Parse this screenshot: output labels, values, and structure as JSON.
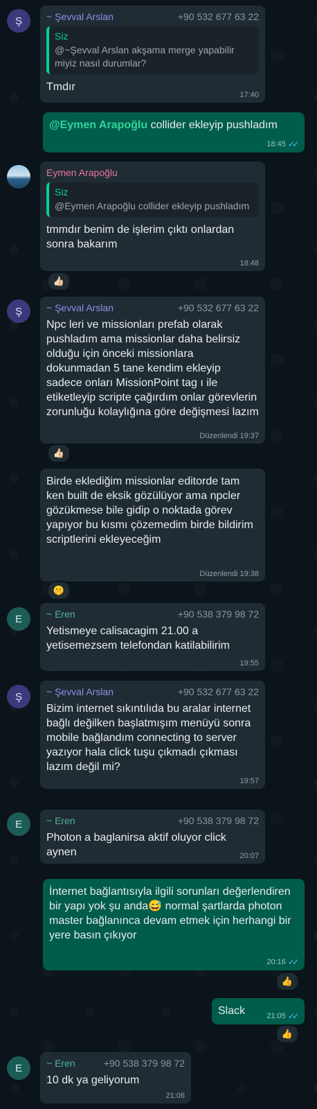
{
  "messages": [
    {
      "sender": "~ Şevval Arslan",
      "phone": "+90 532 677 63 22",
      "avatar": "Ş",
      "quote_name": "Siz",
      "quote_text": "@~Şevval Arslan akşama merge yapabilir miyiz nasıl durumlar?",
      "text": "Tmdır",
      "time": "17:40"
    },
    {
      "mention": "@Eymen Arapoğlu",
      "text": " collider ekleyip pushladım",
      "time": "18:45"
    },
    {
      "sender": "Eymen Arapoğlu",
      "quote_name": "Siz",
      "quote_text": "@Eymen Arapoğlu collider ekleyip pushladım",
      "text": "tmmdır benim de işlerim çıktı onlardan sonra bakarım",
      "time": "18:48",
      "reaction": "👍🏻"
    },
    {
      "sender": "~ Şevval Arslan",
      "phone": "+90 532 677 63 22",
      "avatar": "Ş",
      "text": "Npc leri ve missionları prefab olarak pushladım ama missionlar daha belirsiz olduğu için önceki missionlara dokunmadan 5 tane kendim ekleyip sadece onları MissionPoint tag ı ile etiketleyip scripte çağırdım onlar görevlerin zorunluğu kolaylığına göre değişmesi lazım",
      "time": "Düzenlendi 19:37",
      "reaction": "👍🏻"
    },
    {
      "text": "Birde eklediğim missionlar editorde tam ken built de eksik gözülüyor ama npcler gözükmese bile gidip o noktada görev yapıyor bu kısmı çözemedim birde bildirim scriptlerini ekleyeceğim",
      "time": "Düzenlendi 19:38",
      "reaction": "🤫"
    },
    {
      "sender": "~ Eren",
      "phone": "+90 538 379 98 72",
      "avatar": "E",
      "text": "Yetismeye calisacagim 21.00 a yetisemezsem telefondan katilabilirim",
      "time": "19:55"
    },
    {
      "sender": "~ Şevval Arslan",
      "phone": "+90 532 677 63 22",
      "avatar": "Ş",
      "text": "Bizim internet sıkıntılıda bu aralar internet bağlı değilken başlatmışım menüyü sonra mobile bağlandım connecting to server yazıyor hala click tuşu çıkmadı çıkması lazım değil mi?",
      "time": "19:57"
    },
    {
      "sender": "~ Eren",
      "phone": "+90 538 379 98 72",
      "avatar": "E",
      "text": "Photon a baglanirsa aktif oluyor click aynen",
      "time": "20:07"
    },
    {
      "text": "İnternet bağlantısıyla ilgili sorunları değerlendiren bir yapı yok şu anda😅 normal şartlarda photon master bağlanınca devam etmek için herhangi bir yere basın çıkıyor",
      "time": "20:16",
      "reaction": "👍"
    },
    {
      "text": "Slack",
      "time": "21:05",
      "reaction": "👍"
    },
    {
      "sender": "~ Eren",
      "phone": "+90 538 379 98 72",
      "avatar": "E",
      "text": "10 dk ya geliyorum",
      "time": "21:06"
    }
  ],
  "ticks": "✓✓",
  "colors": {
    "background": "#0b141a",
    "incoming_bubble": "#202c33",
    "outgoing_bubble": "#005c4b",
    "read_ticks": "#53bdeb"
  }
}
